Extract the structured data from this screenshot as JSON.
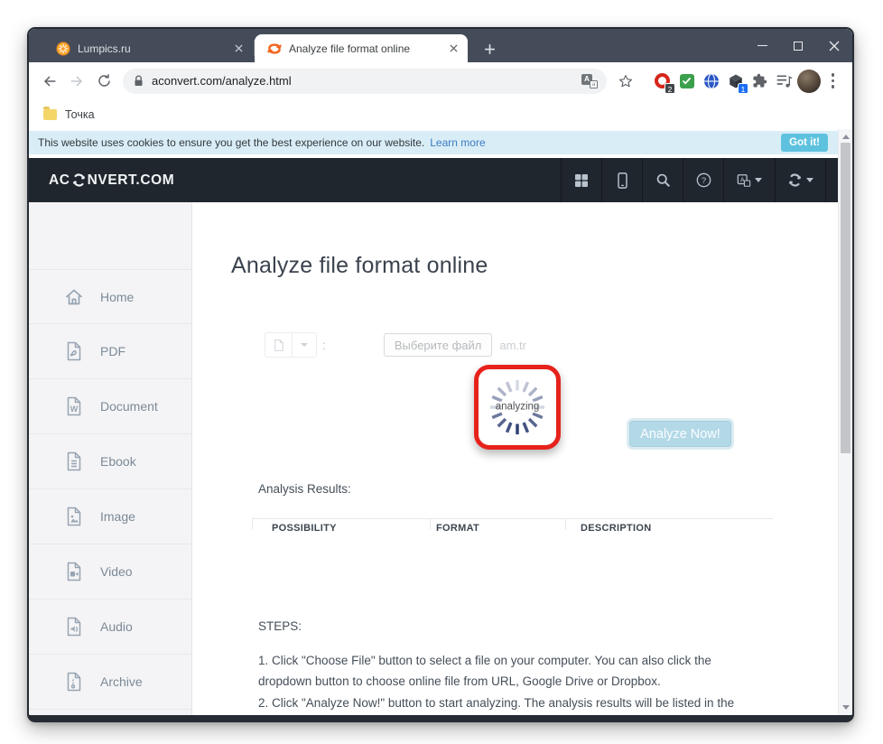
{
  "window": {
    "tabs": [
      {
        "title": "Lumpics.ru"
      },
      {
        "title": "Analyze file format online"
      }
    ]
  },
  "toolbar": {
    "url": "aconvert.com/analyze.html",
    "badges": {
      "red": "2",
      "cube": "1"
    }
  },
  "bookmarks_bar": {
    "folder_label": "Точка"
  },
  "cookie_bar": {
    "message": "This website uses cookies to ensure you get the best experience on our website.",
    "link_label": "Learn more",
    "button_label": "Got it!"
  },
  "navbar": {
    "logo_prefix": "AC",
    "logo_suffix": "NVERT.COM"
  },
  "sidebar": {
    "items": [
      {
        "label": "Home"
      },
      {
        "label": "PDF"
      },
      {
        "label": "Document"
      },
      {
        "label": "Ebook"
      },
      {
        "label": "Image"
      },
      {
        "label": "Video"
      },
      {
        "label": "Audio"
      },
      {
        "label": "Archive"
      }
    ]
  },
  "main": {
    "heading": "Analyze file format online",
    "file_row": {
      "separator": ":",
      "choose_button_label": "Выберите файл",
      "filename": "am.tr"
    },
    "spinner_label": "analyzing",
    "analyze_button_label": "Analyze Now!",
    "results_label": "Analysis Results:",
    "table": {
      "headers": [
        "POSSIBILITY",
        "FORMAT",
        "DESCRIPTION"
      ]
    },
    "steps_label": "STEPS:",
    "steps": [
      "1. Click \"Choose File\" button to select a file on your computer. You can also click the dropdown button to choose online file from URL, Google Drive or Dropbox.",
      "2. Click \"Analyze Now!\" button to start analyzing. The analysis results will be listed in the"
    ]
  },
  "colors": {
    "titlebar_bg": "#454c59",
    "navbar_bg": "#20262e",
    "cookie_bg": "#d9edf7",
    "got_it_bg": "#5ec2df",
    "highlight_red": "#e6221b",
    "analyze_btn_bg": "#b3d9e7"
  }
}
